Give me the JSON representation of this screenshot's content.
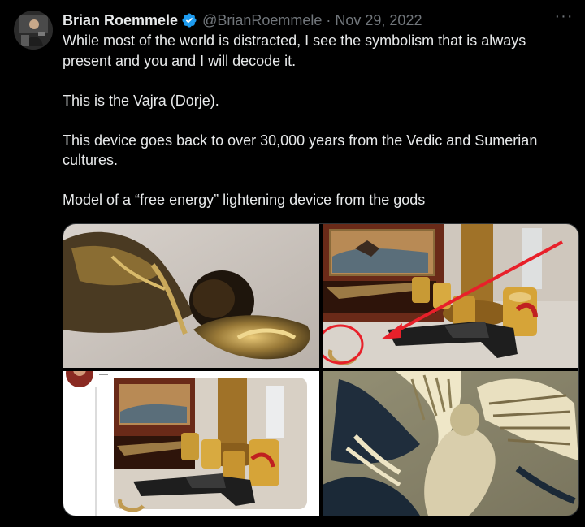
{
  "tweet": {
    "author_name": "Brian Roemmele",
    "handle": "@BrianRoemmele",
    "separator": "·",
    "date": "Nov 29, 2022",
    "more_label": "···",
    "paragraphs": [
      "While most of the world is distracted, I see the symbolism that is always present and you and I will decode it.",
      "This is the Vajra (Dorje).",
      "This device goes back to over 30,000 years from the Vedic and Sumerian cultures.",
      "Model of a “free energy” lightening device from the gods"
    ]
  },
  "media": {
    "images": [
      {
        "subject": "vajra-closeup"
      },
      {
        "subject": "pistol-display-with-arrow"
      },
      {
        "subject": "pistol-display-screenshot"
      },
      {
        "subject": "winged-relief-carving"
      }
    ]
  },
  "colors": {
    "background": "#000000",
    "text": "#e7e9ea",
    "secondary": "#71767b",
    "verified": "#1d9bf0",
    "annotation_red": "#e8202a"
  }
}
